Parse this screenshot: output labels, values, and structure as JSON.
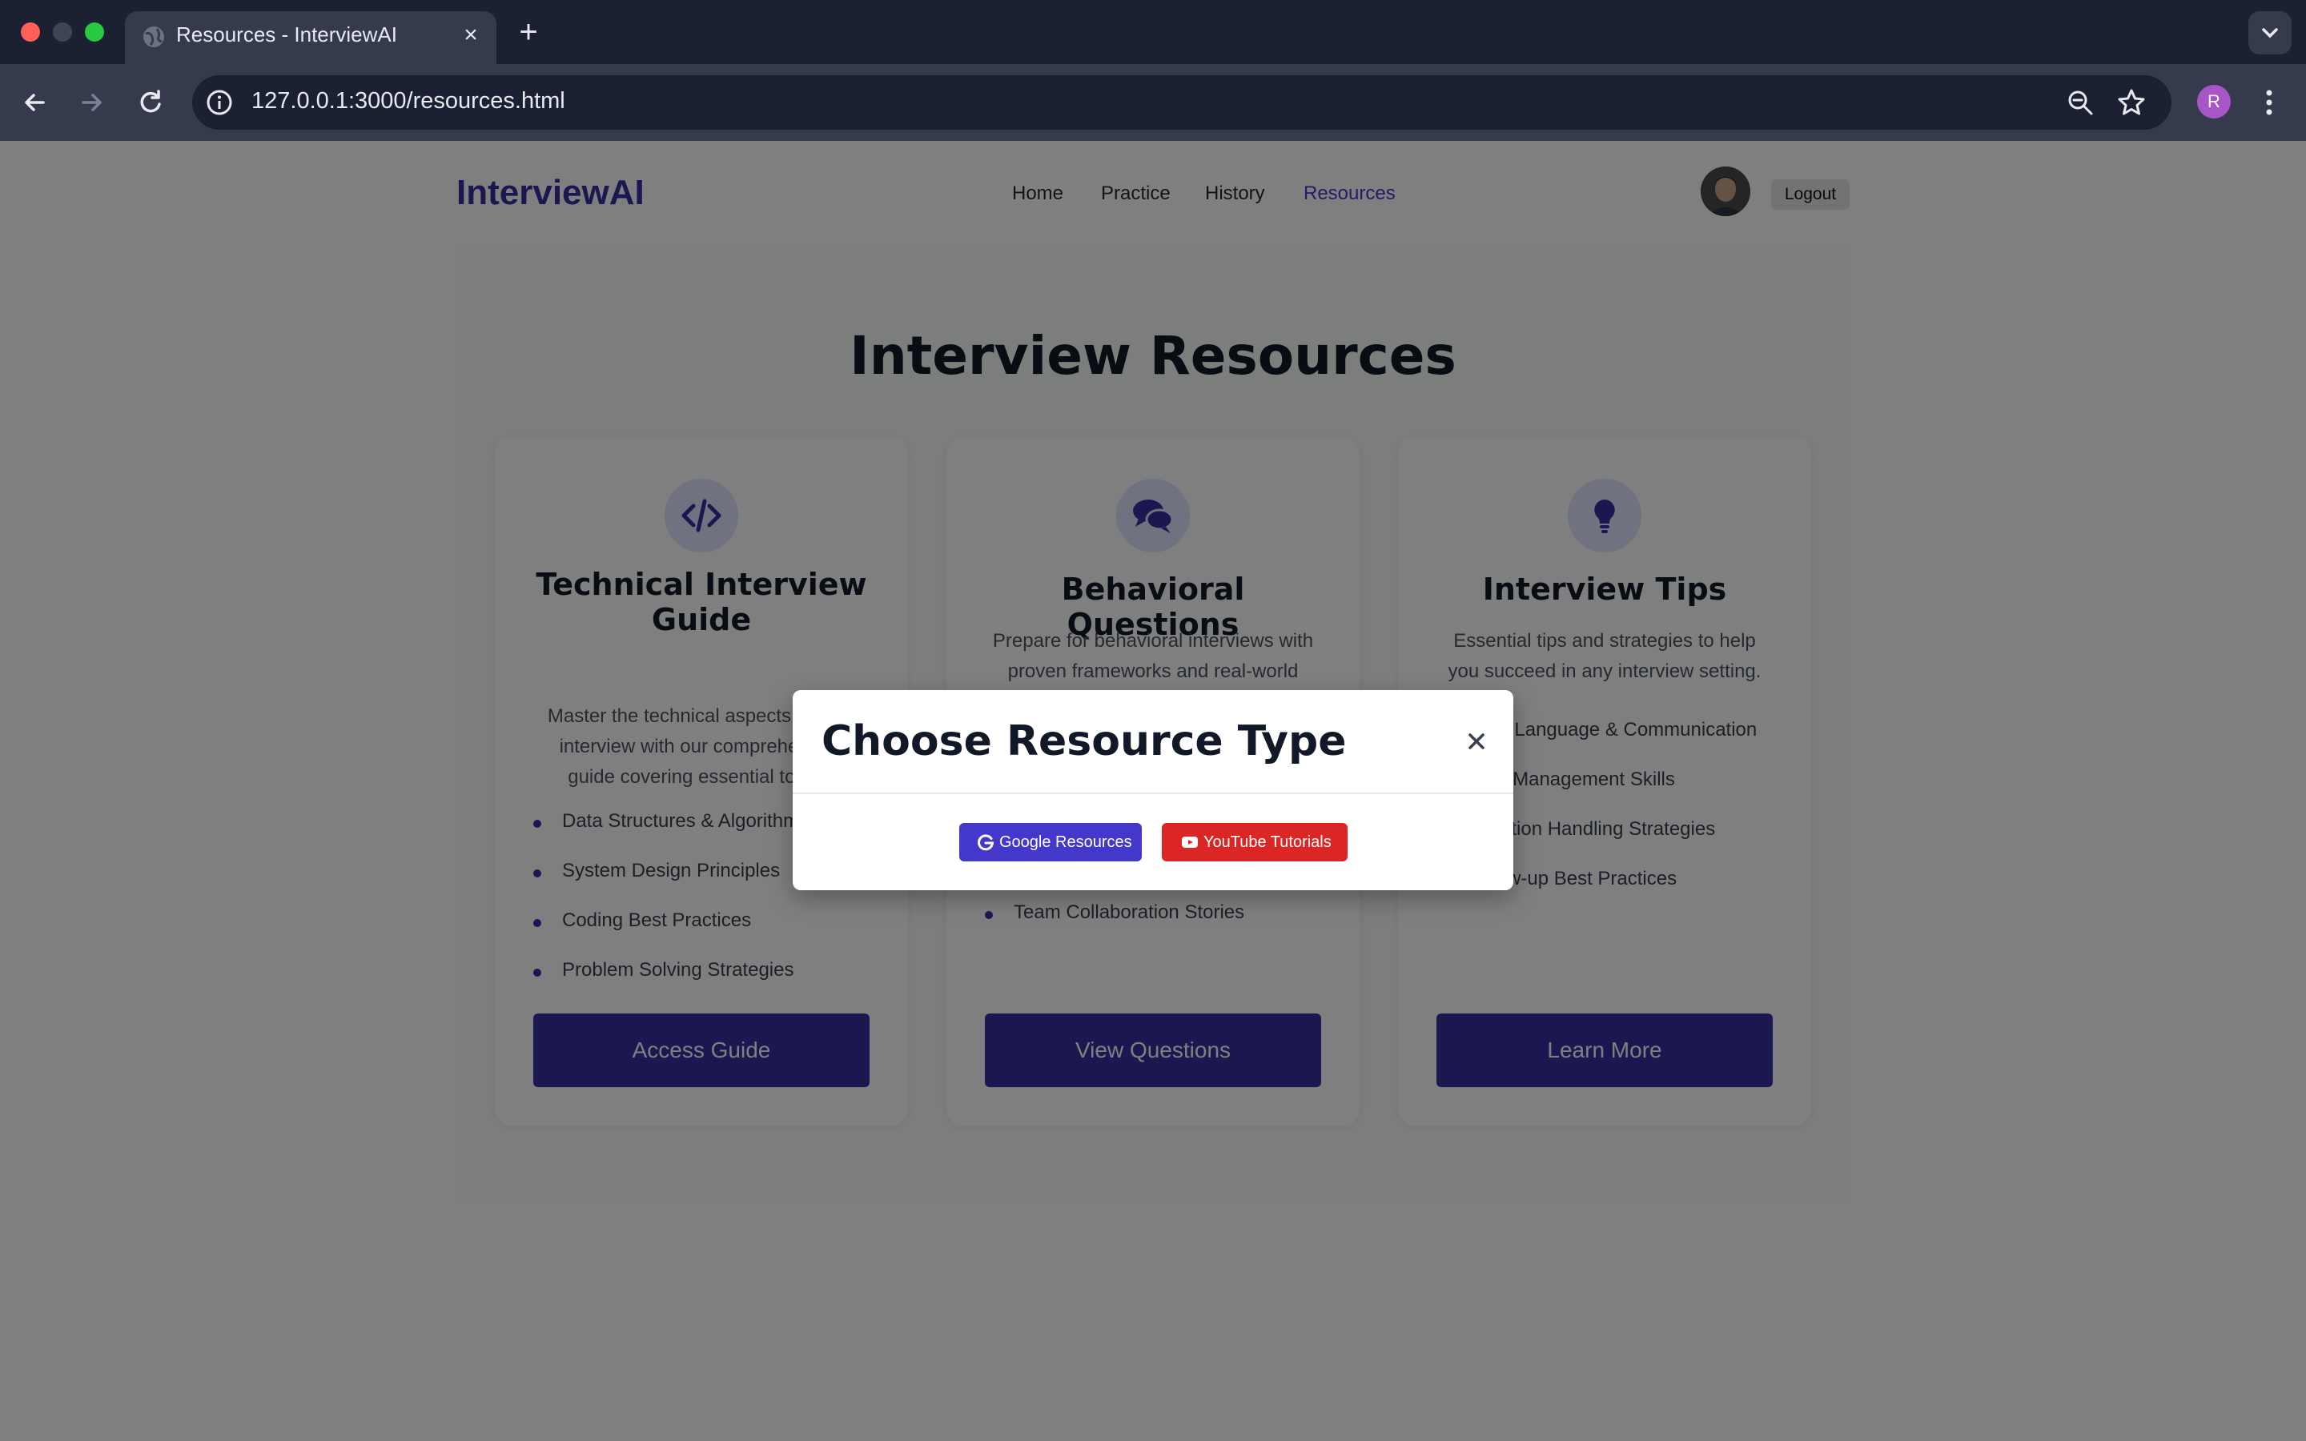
{
  "browser": {
    "tab_title": "Resources - InterviewAI",
    "url": "127.0.0.1:3000/resources.html",
    "profile_initial": "R"
  },
  "site": {
    "logo": "InterviewAI",
    "nav": [
      "Home",
      "Practice",
      "History",
      "Resources"
    ],
    "active_nav": "Resources",
    "logout_label": "Logout"
  },
  "main": {
    "title": "Interview Resources",
    "cards": [
      {
        "icon": "code-icon",
        "title": "Technical Interview Guide",
        "description": "Master the technical aspects of your interview with our comprehensive guide covering essential topics.",
        "items": [
          "Data Structures & Algorithms",
          "System Design Principles",
          "Coding Best Practices",
          "Problem Solving Strategies"
        ],
        "button": "Access Guide"
      },
      {
        "icon": "chat-bubbles-icon",
        "title": "Behavioral Questions",
        "description": "Prepare for behavioral interviews with proven frameworks and real-world examples.",
        "items": [
          "Team Collaboration Stories"
        ],
        "button": "View Questions"
      },
      {
        "icon": "lightbulb-icon",
        "title": "Interview Tips",
        "description": "Essential tips and strategies to help you succeed in any interview setting.",
        "items": [
          "Body Language & Communication",
          "Time Management Skills",
          "Question Handling Strategies",
          "Follow-up Best Practices"
        ],
        "button": "Learn More"
      }
    ]
  },
  "modal": {
    "title": "Choose Resource Type",
    "google_label": "Google Resources",
    "youtube_label": "YouTube Tutorials"
  },
  "colors": {
    "brand": "#3730a3",
    "youtube": "#dc2626"
  }
}
